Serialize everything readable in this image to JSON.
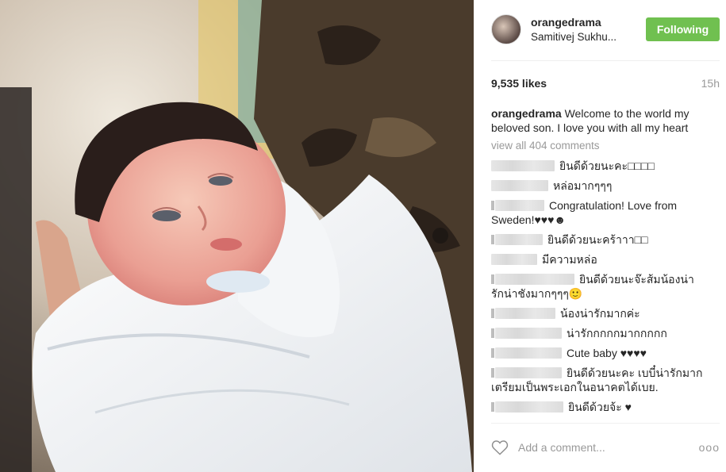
{
  "post": {
    "username": "orangedrama",
    "location": "Samitivej Sukhu...",
    "follow_label": "Following",
    "likes": "9,535 likes",
    "time": "15h",
    "caption": {
      "username": "orangedrama",
      "text": "Welcome to the world my beloved son. I love you with all my heart"
    },
    "view_all": "view all 404 comments",
    "comments": [
      {
        "blur": 80,
        "dot": false,
        "text": "ยินดีด้วยนะคะ□□□□"
      },
      {
        "blur": 72,
        "dot": false,
        "text": "หล่อมากๆๆๆ"
      },
      {
        "blur": 62,
        "dot": true,
        "text": "Congratulation! Love from Sweden!♥♥♥☻"
      },
      {
        "blur": 60,
        "dot": true,
        "text": "ยินดีด้วยนะคร้าาา□□"
      },
      {
        "blur": 58,
        "dot": false,
        "text": "มีความหล่อ"
      },
      {
        "blur": 100,
        "dot": true,
        "text": "ยินดีด้วยนะจ๊ะส้มน้องน่ารักน่าชังมากๆๆๆ🙂"
      },
      {
        "blur": 76,
        "dot": true,
        "text": "น้องน่ารักมากค่ะ"
      },
      {
        "blur": 84,
        "dot": true,
        "text": "น่ารักกกกกมากกกกก"
      },
      {
        "blur": 84,
        "dot": true,
        "text": "Cute baby ♥♥♥♥"
      },
      {
        "blur": 84,
        "dot": true,
        "text": "ยินดีด้วยนะคะ เบบี๋น่ารักมาก เตรียมเป็นพระเอกในอนาคตได้เบย."
      },
      {
        "blur": 86,
        "dot": true,
        "text": "ยินดีด้วยจ้ะ ♥"
      }
    ],
    "add_comment_placeholder": "Add a comment...",
    "more_label": "ooo"
  },
  "colors": {
    "follow_bg": "#70c050",
    "muted": "#999999",
    "text": "#262626"
  },
  "icons": {
    "heart": "heart-outline-icon",
    "more": "more-options-icon"
  }
}
